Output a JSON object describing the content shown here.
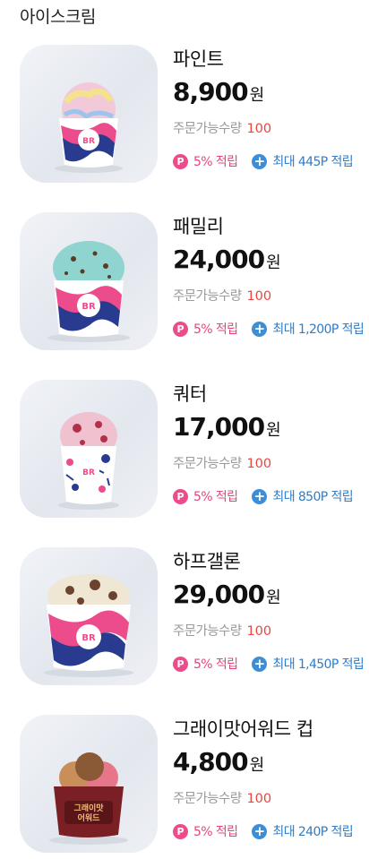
{
  "section": {
    "title": "아이스크림"
  },
  "products": [
    {
      "name": "파인트",
      "price": "8,900",
      "unit": "원",
      "stock_label": "주문가능수량",
      "stock_value": "100",
      "point": "5% 적립",
      "max": "최대 445P 적립",
      "scoop_color": "#f2c9d9",
      "scoop_accent": "#f4e38a"
    },
    {
      "name": "패밀리",
      "price": "24,000",
      "unit": "원",
      "stock_label": "주문가능수량",
      "stock_value": "100",
      "point": "5% 적립",
      "max": "최대 1,200P 적립",
      "scoop_color": "#8fd4cf",
      "scoop_accent": "#5a3b2a"
    },
    {
      "name": "쿼터",
      "price": "17,000",
      "unit": "원",
      "stock_label": "주문가능수량",
      "stock_value": "100",
      "point": "5% 적립",
      "max": "최대 850P 적립",
      "scoop_color": "#f0c2cf",
      "scoop_accent": "#b2304a"
    },
    {
      "name": "하프갤론",
      "price": "29,000",
      "unit": "원",
      "stock_label": "주문가능수량",
      "stock_value": "100",
      "point": "5% 적립",
      "max": "최대 1,450P 적립",
      "scoop_color": "#efe6d3",
      "scoop_accent": "#6b4330"
    },
    {
      "name": "그래이맛어워드 컵",
      "price": "4,800",
      "unit": "원",
      "stock_label": "주문가능수량",
      "stock_value": "100",
      "point": "5% 적립",
      "max": "최대 240P 적립",
      "scoop_color": "#c98f5a",
      "scoop_accent": "#e8768a",
      "cup_text": [
        "그래이맛",
        "어워드"
      ]
    }
  ],
  "icons": {
    "point": "point-icon",
    "plus": "plus-icon"
  }
}
